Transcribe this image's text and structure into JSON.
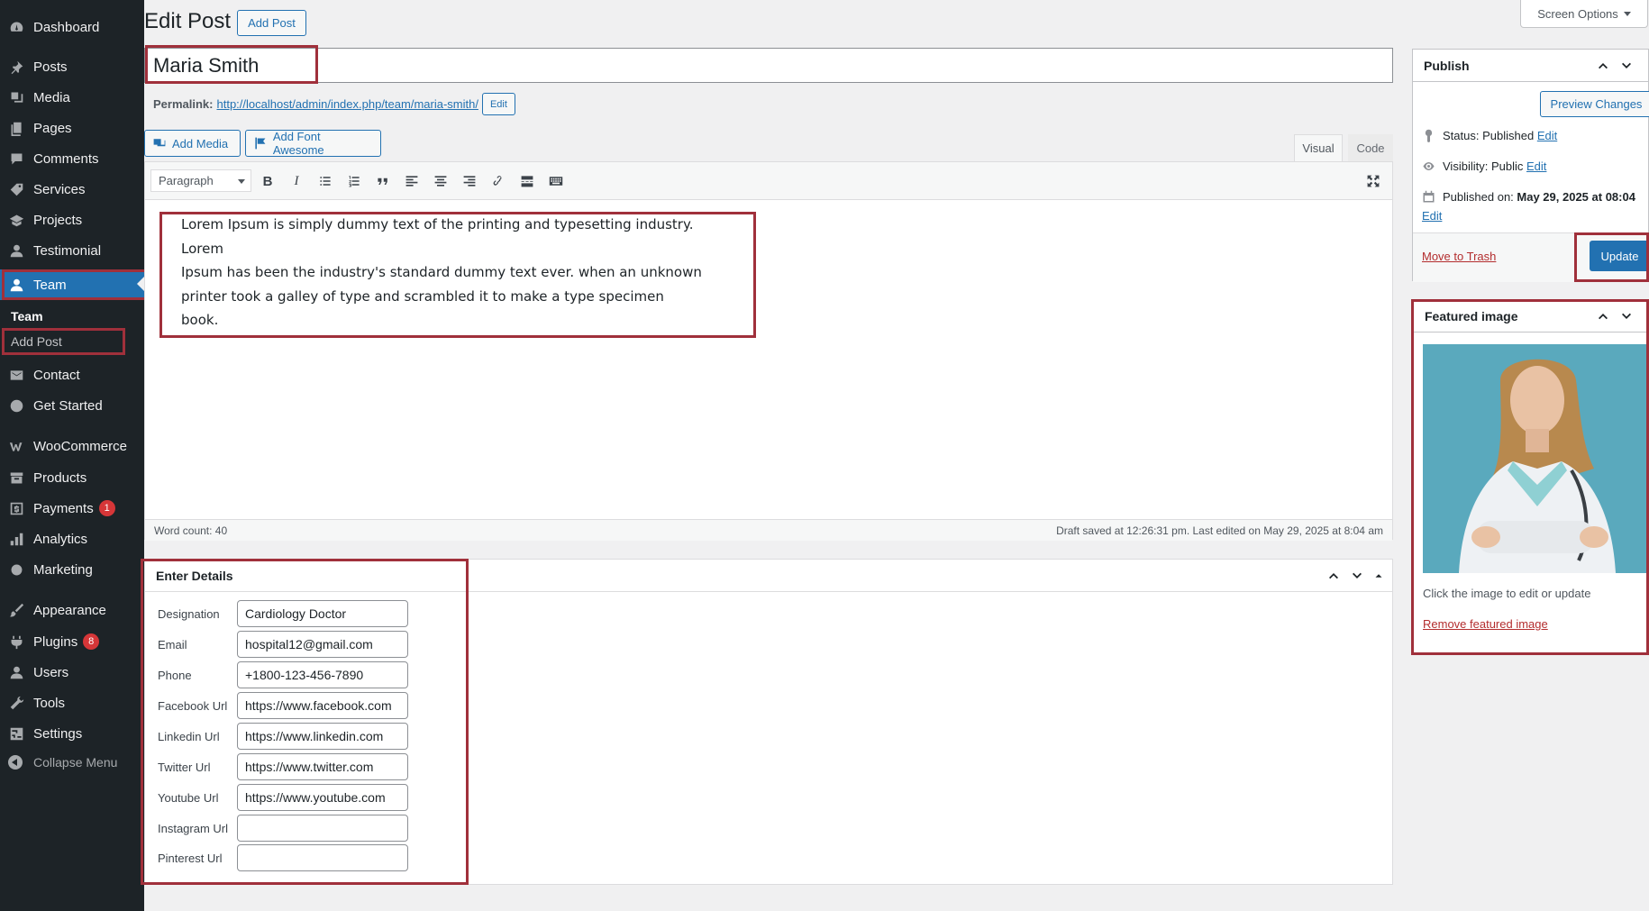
{
  "sidebar": {
    "items": [
      {
        "label": "Dashboard",
        "icon": "dashboard-icon"
      },
      {
        "label": "Posts",
        "icon": "pin-icon"
      },
      {
        "label": "Media",
        "icon": "media-icon"
      },
      {
        "label": "Pages",
        "icon": "pages-icon"
      },
      {
        "label": "Comments",
        "icon": "comments-icon"
      },
      {
        "label": "Services",
        "icon": "tag-icon"
      },
      {
        "label": "Projects",
        "icon": "portfolio-icon"
      },
      {
        "label": "Testimonial",
        "icon": "user-icon"
      },
      {
        "label": "Team",
        "icon": "team-icon"
      },
      {
        "label": "Contact",
        "icon": "mail-icon"
      },
      {
        "label": "Get Started",
        "icon": "globe-icon"
      },
      {
        "label": "WooCommerce",
        "icon": "woocommerce-icon"
      },
      {
        "label": "Products",
        "icon": "archive-icon"
      },
      {
        "label": "Payments",
        "icon": "payments-icon",
        "badge": "1"
      },
      {
        "label": "Analytics",
        "icon": "chart-icon"
      },
      {
        "label": "Marketing",
        "icon": "megaphone-icon"
      },
      {
        "label": "Appearance",
        "icon": "brush-icon"
      },
      {
        "label": "Plugins",
        "icon": "plugin-icon",
        "badge": "8"
      },
      {
        "label": "Users",
        "icon": "users-icon"
      },
      {
        "label": "Tools",
        "icon": "wrench-icon"
      },
      {
        "label": "Settings",
        "icon": "settings-icon"
      }
    ],
    "submenu_title": "Team",
    "submenu_item": "Add Post",
    "collapse_label": "Collapse Menu"
  },
  "header": {
    "title": "Edit Post",
    "add_post": "Add Post",
    "screen_options": "Screen Options"
  },
  "post": {
    "title": "Maria Smith",
    "permalink_label": "Permalink:",
    "permalink_url": "http://localhost/admin/index.php/team/maria-smith/",
    "permalink_edit": "Edit",
    "add_media": "Add Media",
    "add_font_awesome": "Add Font Awesome",
    "tab_visual": "Visual",
    "tab_code": "Code",
    "format": "Paragraph",
    "content_line_1": "Lorem Ipsum is simply dummy text of the printing and typesetting industry. Lorem",
    "content_line_2": "Ipsum has been the industry's standard dummy text ever. when an unknown",
    "content_line_3": "printer took a galley of type and scrambled it to make a type specimen book.",
    "word_count": "Word count: 40",
    "draft_status": "Draft saved at 12:26:31 pm. Last edited on May 29, 2025 at 8:04 am"
  },
  "details": {
    "title": "Enter Details",
    "fields": [
      {
        "label": "Designation",
        "value": "Cardiology Doctor"
      },
      {
        "label": "Email",
        "value": "hospital12@gmail.com"
      },
      {
        "label": "Phone",
        "value": "+1800-123-456-7890"
      },
      {
        "label": "Facebook Url",
        "value": "https://www.facebook.com"
      },
      {
        "label": "Linkedin Url",
        "value": "https://www.linkedin.com"
      },
      {
        "label": "Twitter Url",
        "value": "https://www.twitter.com"
      },
      {
        "label": "Youtube Url",
        "value": "https://www.youtube.com"
      },
      {
        "label": "Instagram Url",
        "value": ""
      },
      {
        "label": "Pinterest Url",
        "value": ""
      }
    ]
  },
  "publish": {
    "title": "Publish",
    "preview": "Preview Changes",
    "status_label": "Status:",
    "status_value": "Published",
    "visibility_label": "Visibility:",
    "visibility_value": "Public",
    "published_label": "Published on:",
    "published_value": "May 29, 2025 at 08:04",
    "edit": "Edit",
    "trash": "Move to Trash",
    "update": "Update"
  },
  "featured": {
    "title": "Featured image",
    "hint": "Click the image to edit or update",
    "remove": "Remove featured image"
  },
  "colors": {
    "sidebar_bg": "#1d2327",
    "accent": "#2271b1",
    "highlight": "#a0303b",
    "badge": "#d63638"
  }
}
